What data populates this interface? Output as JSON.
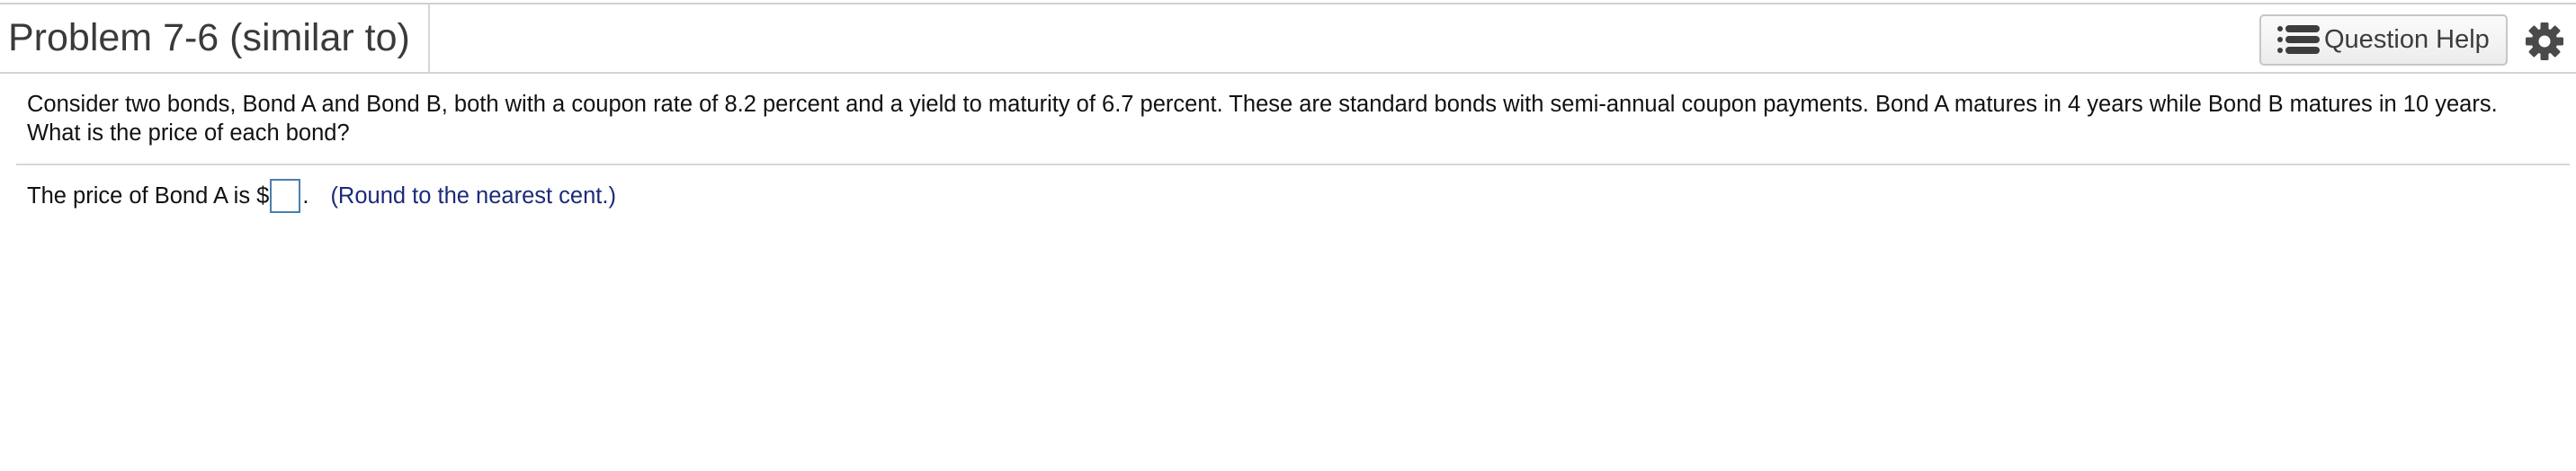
{
  "header": {
    "title": "Problem 7-6 (similar to)",
    "help_button_label": "Question Help",
    "help_icon": "list-icon",
    "settings_icon": "gear-icon"
  },
  "question": {
    "text": "Consider two bonds, Bond A and Bond B, both with a coupon rate of 8.2 percent and a yield to maturity of 6.7 percent. These are standard bonds with semi-annual coupon payments. Bond A matures in 4 years while Bond B matures in 10 years. What is the price of each bond?"
  },
  "answer": {
    "prefix": "The price of Bond A is $",
    "input_value": "",
    "suffix": ".",
    "hint": "(Round to the nearest cent.)"
  },
  "colors": {
    "hint": "#1c2a7a",
    "input_border": "#4a7fb0",
    "title": "#3a3a3a"
  }
}
